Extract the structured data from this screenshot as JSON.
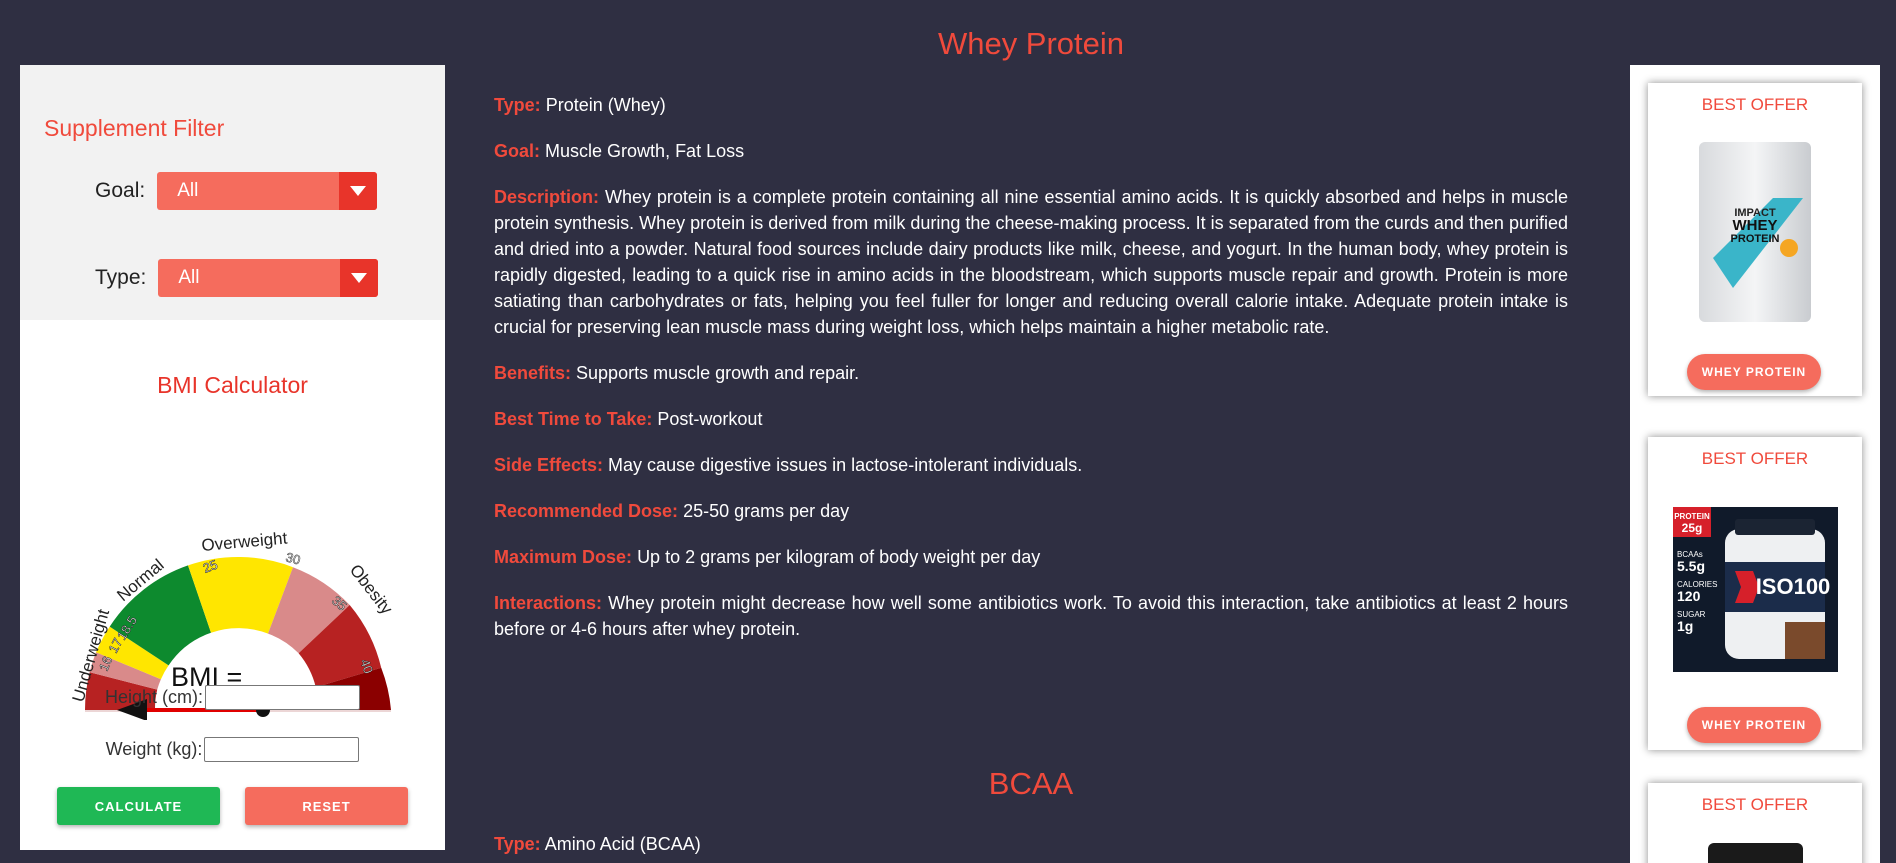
{
  "sidebar": {
    "filter_title": "Supplement Filter",
    "goal_label": "Goal:",
    "goal_value": "All",
    "type_label": "Type:",
    "type_value": "All",
    "bmi_title": "BMI Calculator",
    "gauge": {
      "bmi_text": "BMI =",
      "labels": [
        "Underweight",
        "Normal",
        "Overweight",
        "Obesity"
      ],
      "ticks": [
        "16",
        "17",
        "18.5",
        "25",
        "30",
        "35",
        "40"
      ]
    },
    "height_label": "Height (cm):",
    "weight_label": "Weight (kg):",
    "calculate_label": "CALCULATE",
    "reset_label": "RESET"
  },
  "main": {
    "whey": {
      "title": "Whey Protein",
      "type_key": "Type:",
      "type_val": "Protein (Whey)",
      "goal_key": "Goal:",
      "goal_val": "Muscle Growth, Fat Loss",
      "desc_key": "Description:",
      "desc_val": "Whey protein is a complete protein containing all nine essential amino acids. It is quickly absorbed and helps in muscle protein synthesis. Whey protein is derived from milk during the cheese-making process. It is separated from the curds and then purified and dried into a powder. Natural food sources include dairy products like milk, cheese, and yogurt. In the human body, whey protein is rapidly digested, leading to a quick rise in amino acids in the bloodstream, which supports muscle repair and growth. Protein is more satiating than carbohydrates or fats, helping you feel fuller for longer and reducing overall calorie intake. Adequate protein intake is crucial for preserving lean muscle mass during weight loss, which helps maintain a higher metabolic rate.",
      "benefits_key": "Benefits:",
      "benefits_val": "Supports muscle growth and repair.",
      "time_key": "Best Time to Take:",
      "time_val": "Post-workout",
      "side_key": "Side Effects:",
      "side_val": "May cause digestive issues in lactose-intolerant individuals.",
      "dose_key": "Recommended Dose:",
      "dose_val": "25-50 grams per day",
      "max_key": "Maximum Dose:",
      "max_val": "Up to 2 grams per kilogram of body weight per day",
      "inter_key": "Interactions:",
      "inter_val": "Whey protein might decrease how well some antibiotics work. To avoid this interaction, take antibiotics at least 2 hours before or 4-6 hours after whey protein."
    },
    "bcaa": {
      "title": "BCAA",
      "type_key": "Type:",
      "type_val": "Amino Acid (BCAA)"
    }
  },
  "offers": [
    {
      "title": "BEST OFFER",
      "button": "WHEY PROTEIN",
      "pack_text": "IMPACT WHEY PROTEIN"
    },
    {
      "title": "BEST OFFER",
      "button": "WHEY PROTEIN",
      "pack_text": "ISO100",
      "badge_a": "PROTEIN 25g",
      "stat1": "BCAAs 5.5g",
      "stat2": "CALORIES 120",
      "stat3": "SUGAR 1g"
    },
    {
      "title": "BEST OFFER"
    }
  ]
}
